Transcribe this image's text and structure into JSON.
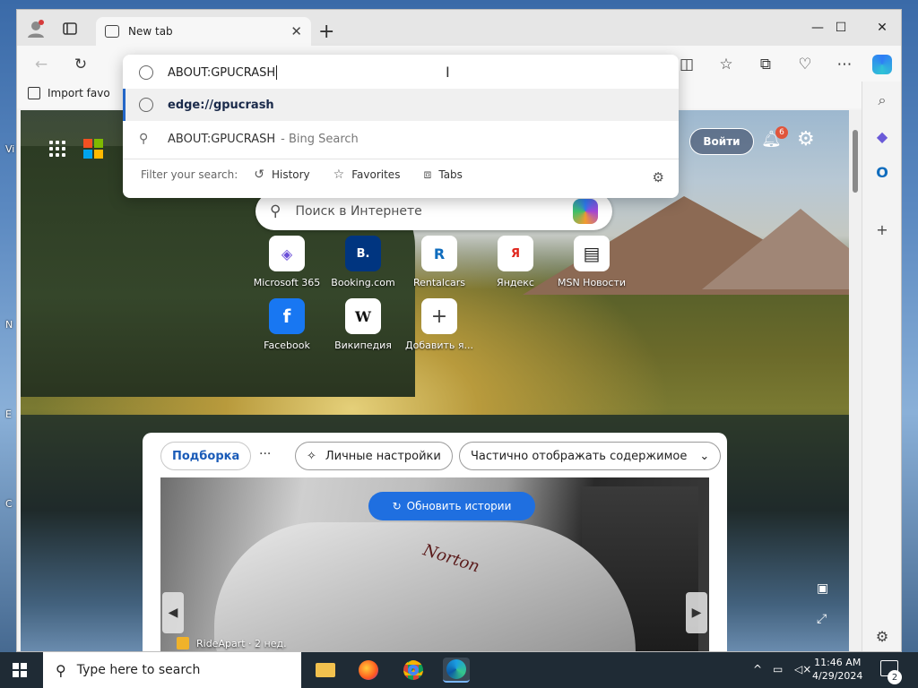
{
  "window": {
    "tab_title": "New tab",
    "favorites_item": "Import favo"
  },
  "omnibox": {
    "input_value": "ABOUT:GPUCRASH",
    "suggestions": [
      {
        "text": "edge://gpucrash",
        "suffix": ""
      },
      {
        "text": "ABOUT:GPUCRASH",
        "suffix": "- Bing Search"
      }
    ],
    "filter_label": "Filter your search:",
    "filters": [
      "History",
      "Favorites",
      "Tabs"
    ]
  },
  "page": {
    "signin_label": "Войти",
    "notification_count": "6",
    "search_placeholder": "Поиск в Интернете",
    "tiles": [
      {
        "label": "Microsoft 365",
        "glyph": "◈"
      },
      {
        "label": "Booking.com",
        "glyph": "B."
      },
      {
        "label": "Rentalcars",
        "glyph": "R"
      },
      {
        "label": "Яндекс",
        "glyph": "Я"
      },
      {
        "label": "MSN Новости",
        "glyph": "▤"
      },
      {
        "label": "Facebook",
        "glyph": "f"
      },
      {
        "label": "Википедия",
        "glyph": "W"
      },
      {
        "label": "Добавить я...",
        "glyph": "+"
      }
    ]
  },
  "feed": {
    "tab_active": "Подборка",
    "more": "···",
    "personalize": "Личные настройки",
    "content_toggle": "Частично отображать содержимое",
    "refresh_label": "Обновить истории",
    "hero_brand": "Norton",
    "hero_source": "RideApart · 2 нед."
  },
  "taskbar": {
    "search_placeholder": "Type here to search",
    "time": "11:46 AM",
    "date": "4/29/2024",
    "notification_count": "2"
  },
  "colors": {
    "accent": "#1f6fe0",
    "taskbar": "#1f2b35",
    "notification_badge": "#e0553b"
  }
}
